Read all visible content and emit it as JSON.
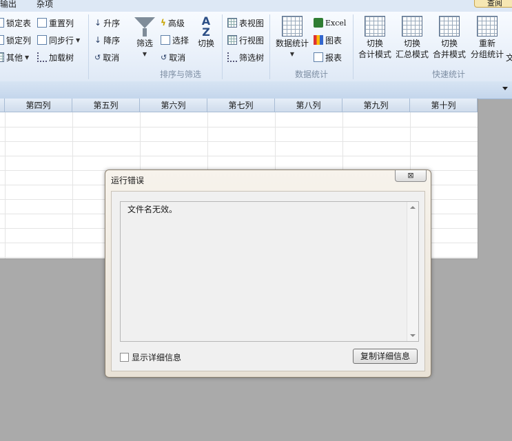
{
  "tabs": [
    {
      "label": "输出"
    },
    {
      "label": "杂项"
    }
  ],
  "help_label": "查阅",
  "ribbon": {
    "col1": [
      "锁定表",
      "锁定列",
      "其他"
    ],
    "col2": [
      "重置列",
      "同步行",
      "加载树"
    ],
    "sort": {
      "asc": "升序",
      "desc": "降序",
      "cancel": "取消",
      "filter": "筛选",
      "advanced": "高级",
      "select": "选择",
      "cancel2": "取消",
      "switch": "切换",
      "group": "排序与筛选"
    },
    "views": {
      "table": "表视图",
      "row": "行视图",
      "filter_tree": "筛选树"
    },
    "stats": {
      "big": "数据统计",
      "excel": "Excel",
      "chart": "图表",
      "report": "报表",
      "group": "数据统计"
    },
    "quick": {
      "items": [
        {
          "l1": "切换",
          "l2": "合计模式"
        },
        {
          "l1": "切换",
          "l2": "汇总模式"
        },
        {
          "l1": "切换",
          "l2": "合并模式"
        },
        {
          "l1": "重新",
          "l2": "分组统计"
        }
      ],
      "cut": "文",
      "group": "快速统计"
    }
  },
  "columns": [
    "第四列",
    "第五列",
    "第六列",
    "第七列",
    "第八列",
    "第九列",
    "第十列"
  ],
  "dialog": {
    "title": "运行错误",
    "close": "⊠",
    "message": "文件名无效。",
    "show_details": "显示详细信息",
    "copy_button": "复制详细信息"
  }
}
